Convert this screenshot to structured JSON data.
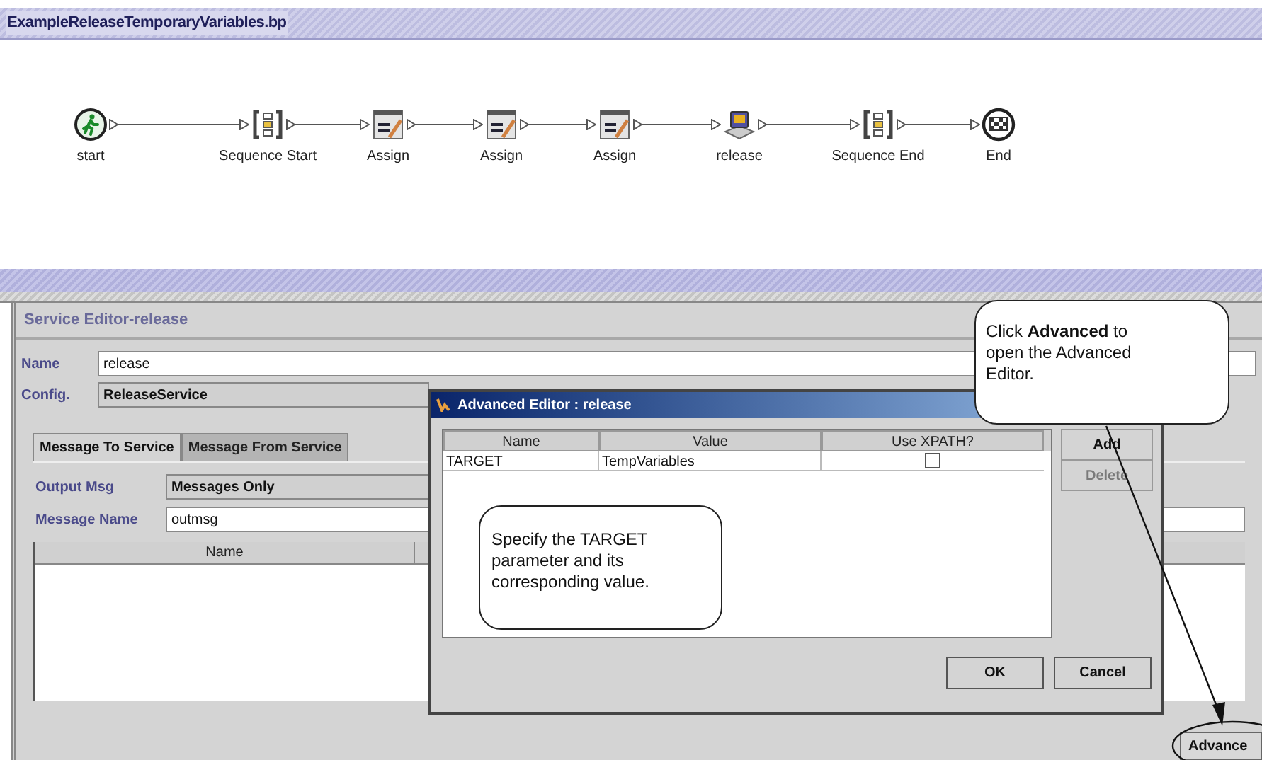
{
  "document_tab": {
    "title": "ExampleReleaseTemporaryVariables.bp"
  },
  "flow": {
    "nodes": [
      {
        "kind": "start",
        "label": "start"
      },
      {
        "kind": "sequence",
        "label": "Sequence Start"
      },
      {
        "kind": "assign",
        "label": "Assign"
      },
      {
        "kind": "assign",
        "label": "Assign"
      },
      {
        "kind": "assign",
        "label": "Assign"
      },
      {
        "kind": "service",
        "label": "release"
      },
      {
        "kind": "sequence",
        "label": "Sequence End"
      },
      {
        "kind": "end",
        "label": "End"
      }
    ]
  },
  "service_editor": {
    "title": "Service Editor-release",
    "fields": [
      {
        "label": "Name",
        "value": "release",
        "kind": "text"
      },
      {
        "label": "Config.",
        "value": "ReleaseService",
        "kind": "readonly"
      }
    ],
    "tabs": [
      {
        "label": "Message To Service",
        "selected": true
      },
      {
        "label": "Message From Service",
        "selected": false
      }
    ],
    "message_fields": [
      {
        "label": "Output Msg",
        "value": "Messages Only",
        "kind": "readonly"
      },
      {
        "label": "Message Name",
        "value": "outmsg",
        "kind": "text"
      }
    ],
    "table": {
      "columns": [
        "Name"
      ]
    },
    "buttons": [
      "Advance"
    ]
  },
  "dialog": {
    "title": "Advanced Editor : release",
    "table": {
      "columns": [
        "Name",
        "Value",
        "Use XPATH?"
      ],
      "rows": [
        {
          "name": "TARGET",
          "value": "TempVariables",
          "use_xpath": false
        }
      ]
    },
    "side_buttons": [
      {
        "label": "Add",
        "disabled": false
      },
      {
        "label": "Delete",
        "disabled": true
      }
    ],
    "buttons": [
      "OK",
      "Cancel"
    ]
  },
  "callouts": [
    {
      "text": "Specify the TARGET parameter and its corresponding value."
    },
    {
      "text": "Click **Advanced**  to open the Advanced Editor."
    }
  ]
}
